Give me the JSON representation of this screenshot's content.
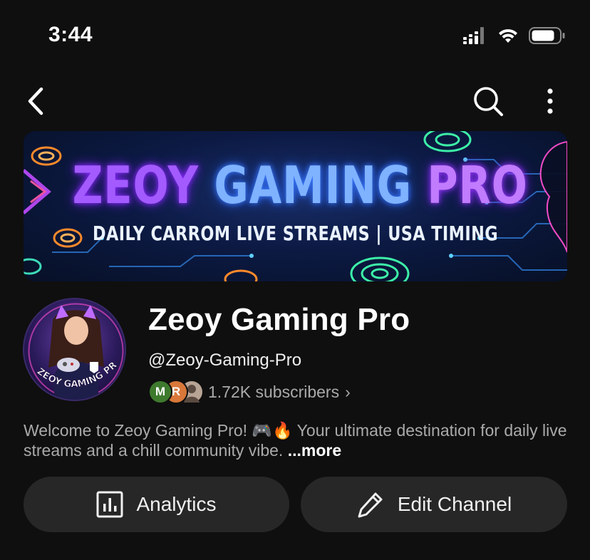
{
  "status_bar": {
    "time": "3:44"
  },
  "nav": {
    "back_icon": "chevron-left-icon",
    "search_icon": "search-icon",
    "more_icon": "more-vertical-icon"
  },
  "banner": {
    "title_word1": "ZEOY",
    "title_word2": "GAMING",
    "title_word3": "PRO",
    "subtitle": "DAILY CARROM LIVE STREAMS | USA TIMING"
  },
  "avatar": {
    "text": "ZEOY GAMING PRO"
  },
  "channel": {
    "name": "Zeoy Gaming Pro",
    "handle": "@Zeoy-Gaming-Pro",
    "subscriber_avatars": [
      "M",
      "R",
      ""
    ],
    "subscribers": "1.72K subscribers",
    "subscribers_chevron": "›"
  },
  "description": {
    "text": "Welcome to Zeoy Gaming Pro! 🎮🔥 Your ultimate destination for daily live streams and a chill community vibe. ",
    "more": "...more"
  },
  "buttons": {
    "analytics": "Analytics",
    "edit_channel": "Edit Channel"
  },
  "colors": {
    "background": "#0f0f0f",
    "button_bg": "#272727",
    "secondary_text": "#aaaaaa"
  }
}
